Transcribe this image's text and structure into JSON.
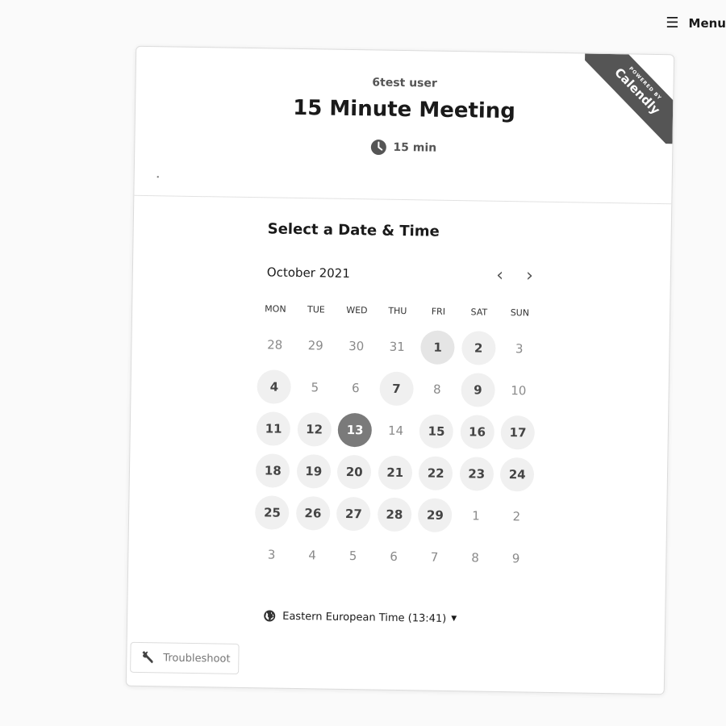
{
  "menu": {
    "label": "Menu",
    "icon": "menu-icon"
  },
  "ribbon": {
    "powered_by": "POWERED BY",
    "brand": "Calendly"
  },
  "event": {
    "host": "6test user",
    "title": "15 Minute Meeting",
    "duration": "15 min",
    "duration_icon": "clock-icon"
  },
  "calendar": {
    "section_title": "Select a Date & Time",
    "month": "October 2021",
    "prev_icon": "chevron-left-icon",
    "next_icon": "chevron-right-icon",
    "weekdays": [
      "MON",
      "TUE",
      "WED",
      "THU",
      "FRI",
      "SAT",
      "SUN"
    ],
    "weeks": [
      [
        {
          "d": "28",
          "s": "out"
        },
        {
          "d": "29",
          "s": "out"
        },
        {
          "d": "30",
          "s": "out"
        },
        {
          "d": "31",
          "s": "out"
        },
        {
          "d": "1",
          "s": "hl"
        },
        {
          "d": "2",
          "s": "avail"
        },
        {
          "d": "3",
          "s": "off"
        }
      ],
      [
        {
          "d": "4",
          "s": "avail"
        },
        {
          "d": "5",
          "s": "off"
        },
        {
          "d": "6",
          "s": "off"
        },
        {
          "d": "7",
          "s": "avail"
        },
        {
          "d": "8",
          "s": "off"
        },
        {
          "d": "9",
          "s": "avail"
        },
        {
          "d": "10",
          "s": "off"
        }
      ],
      [
        {
          "d": "11",
          "s": "avail"
        },
        {
          "d": "12",
          "s": "avail"
        },
        {
          "d": "13",
          "s": "sel"
        },
        {
          "d": "14",
          "s": "off"
        },
        {
          "d": "15",
          "s": "avail"
        },
        {
          "d": "16",
          "s": "avail"
        },
        {
          "d": "17",
          "s": "avail"
        }
      ],
      [
        {
          "d": "18",
          "s": "avail"
        },
        {
          "d": "19",
          "s": "avail"
        },
        {
          "d": "20",
          "s": "avail"
        },
        {
          "d": "21",
          "s": "avail"
        },
        {
          "d": "22",
          "s": "avail"
        },
        {
          "d": "23",
          "s": "avail"
        },
        {
          "d": "24",
          "s": "avail"
        }
      ],
      [
        {
          "d": "25",
          "s": "avail"
        },
        {
          "d": "26",
          "s": "avail"
        },
        {
          "d": "27",
          "s": "avail"
        },
        {
          "d": "28",
          "s": "avail"
        },
        {
          "d": "29",
          "s": "avail"
        },
        {
          "d": "1",
          "s": "out"
        },
        {
          "d": "2",
          "s": "out"
        }
      ],
      [
        {
          "d": "3",
          "s": "out"
        },
        {
          "d": "4",
          "s": "out"
        },
        {
          "d": "5",
          "s": "out"
        },
        {
          "d": "6",
          "s": "out"
        },
        {
          "d": "7",
          "s": "out"
        },
        {
          "d": "8",
          "s": "out"
        },
        {
          "d": "9",
          "s": "out"
        }
      ]
    ],
    "selected_day": "13"
  },
  "timezone": {
    "label": "Eastern European Time (13:41)",
    "icon": "globe-icon"
  },
  "troubleshoot": {
    "label": "Troubleshoot",
    "icon": "wrench-icon"
  },
  "colors": {
    "selected": "#7a7a7a",
    "available_bg": "#f0f0f0",
    "ribbon": "#555555"
  }
}
